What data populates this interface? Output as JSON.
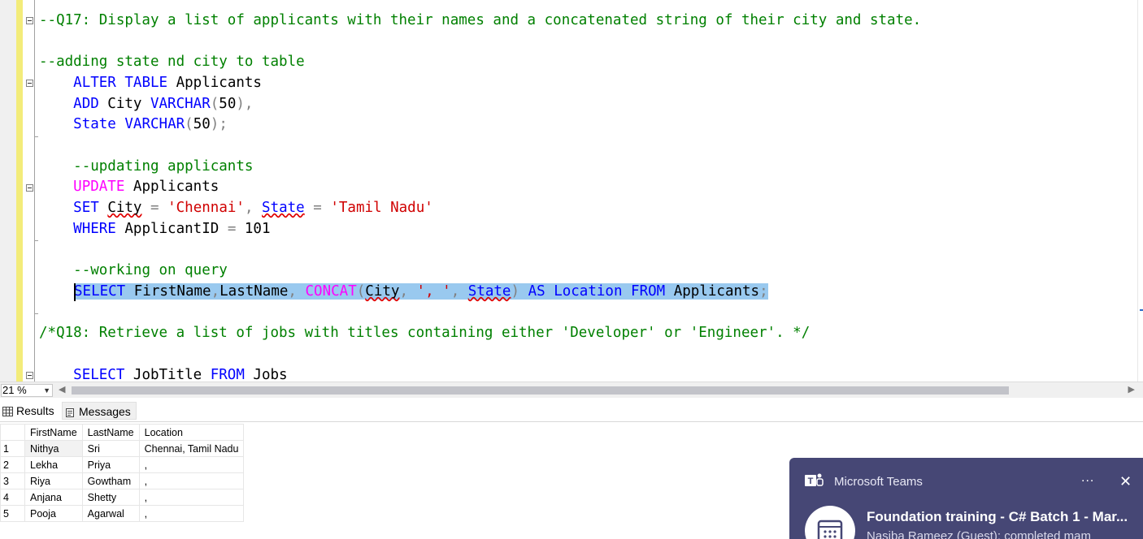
{
  "editor": {
    "lines": [
      {
        "id": "q17",
        "tokens": [
          {
            "t": "--Q17: Display a list of applicants with their names and a concatenated string of their city and state.",
            "c": "cm"
          }
        ]
      },
      {
        "id": "adding",
        "tokens": [
          {
            "t": "--adding state nd city to table",
            "c": "cm"
          }
        ]
      },
      {
        "id": "alter",
        "tokens": [
          {
            "t": "    "
          },
          {
            "t": "ALTER TABLE",
            "c": "kw"
          },
          {
            "t": " Applicants"
          }
        ]
      },
      {
        "id": "add",
        "tokens": [
          {
            "t": "    "
          },
          {
            "t": "ADD",
            "c": "kw"
          },
          {
            "t": " City "
          },
          {
            "t": "VARCHAR",
            "c": "kw"
          },
          {
            "t": "(",
            "c": "gr"
          },
          {
            "t": "50"
          },
          {
            "t": "),",
            "c": "gr"
          }
        ]
      },
      {
        "id": "state",
        "tokens": [
          {
            "t": "    "
          },
          {
            "t": "State",
            "c": "kw"
          },
          {
            "t": " "
          },
          {
            "t": "VARCHAR",
            "c": "kw"
          },
          {
            "t": "(",
            "c": "gr"
          },
          {
            "t": "50"
          },
          {
            "t": ");",
            "c": "gr"
          }
        ]
      },
      {
        "id": "upd-comment",
        "tokens": [
          {
            "t": "    "
          },
          {
            "t": "--updating applicants",
            "c": "cm"
          }
        ]
      },
      {
        "id": "update",
        "tokens": [
          {
            "t": "    "
          },
          {
            "t": "UPDATE",
            "c": "fn"
          },
          {
            "t": " Applicants"
          }
        ]
      },
      {
        "id": "set",
        "tokens": [
          {
            "t": "    "
          },
          {
            "t": "SET",
            "c": "kw"
          },
          {
            "t": " "
          },
          {
            "t": "City",
            "c": "sq"
          },
          {
            "t": " "
          },
          {
            "t": "=",
            "c": "gr"
          },
          {
            "t": " "
          },
          {
            "t": "'Chennai'",
            "c": "str"
          },
          {
            "t": ",",
            "c": "gr"
          },
          {
            "t": " "
          },
          {
            "t": "State",
            "c": "kw sq"
          },
          {
            "t": " "
          },
          {
            "t": "=",
            "c": "gr"
          },
          {
            "t": " "
          },
          {
            "t": "'Tamil Nadu'",
            "c": "str"
          }
        ]
      },
      {
        "id": "where",
        "tokens": [
          {
            "t": "    "
          },
          {
            "t": "WHERE",
            "c": "kw"
          },
          {
            "t": " ApplicantID "
          },
          {
            "t": "=",
            "c": "gr"
          },
          {
            "t": " 101"
          }
        ]
      },
      {
        "id": "query-comment",
        "tokens": [
          {
            "t": "    "
          },
          {
            "t": "--working on query",
            "c": "cm"
          }
        ]
      },
      {
        "id": "select",
        "selected": true,
        "tokens": [
          {
            "t": "SELECT",
            "c": "kw"
          },
          {
            "t": " FirstName"
          },
          {
            "t": ",",
            "c": "gr"
          },
          {
            "t": "LastName"
          },
          {
            "t": ",",
            "c": "gr"
          },
          {
            "t": " "
          },
          {
            "t": "CONCAT",
            "c": "fn"
          },
          {
            "t": "(",
            "c": "gr"
          },
          {
            "t": "City",
            "c": "sq"
          },
          {
            "t": ",",
            "c": "gr"
          },
          {
            "t": " "
          },
          {
            "t": "', '",
            "c": "str"
          },
          {
            "t": ",",
            "c": "gr"
          },
          {
            "t": " "
          },
          {
            "t": "State",
            "c": "kw sq"
          },
          {
            "t": ")",
            "c": "gr"
          },
          {
            "t": " "
          },
          {
            "t": "AS",
            "c": "kw"
          },
          {
            "t": " "
          },
          {
            "t": "Location",
            "c": "kw"
          },
          {
            "t": " "
          },
          {
            "t": "FROM",
            "c": "kw"
          },
          {
            "t": " Applicants"
          },
          {
            "t": ";",
            "c": "gr"
          }
        ]
      },
      {
        "id": "q18",
        "tokens": [
          {
            "t": "/*Q18: Retrieve a list of jobs with titles containing either 'Developer' or 'Engineer'. */",
            "c": "cm"
          }
        ]
      },
      {
        "id": "select-jobs",
        "tokens": [
          {
            "t": "    "
          },
          {
            "t": "SELECT",
            "c": "kw"
          },
          {
            "t": " JobTitle "
          },
          {
            "t": "FROM",
            "c": "kw"
          },
          {
            "t": " Jobs"
          }
        ]
      }
    ]
  },
  "status": {
    "zoom": "21 %"
  },
  "tabs": {
    "results": "Results",
    "messages": "Messages"
  },
  "results": {
    "columns": [
      "FirstName",
      "LastName",
      "Location"
    ],
    "rows": [
      {
        "n": "1",
        "cells": [
          "Nithya",
          "Sri",
          "Chennai, Tamil Nadu"
        ]
      },
      {
        "n": "2",
        "cells": [
          "Lekha",
          "Priya",
          ","
        ]
      },
      {
        "n": "3",
        "cells": [
          "Riya",
          "Gowtham",
          ","
        ]
      },
      {
        "n": "4",
        "cells": [
          "Anjana",
          "Shetty",
          ","
        ]
      },
      {
        "n": "5",
        "cells": [
          "Pooja",
          "Agarwal",
          ","
        ]
      }
    ]
  },
  "toast": {
    "app": "Microsoft Teams",
    "more": "...",
    "close": "✕",
    "title": "Foundation training - C# Batch 1 - Mar...",
    "body": "Nasiba Rameez (Guest): completed mam"
  },
  "colors": {
    "selection": "#99c9ef",
    "teams": "#464775",
    "comment": "#008000",
    "keyword": "#0000ff",
    "function": "#ff00ff",
    "string": "#d00000"
  }
}
